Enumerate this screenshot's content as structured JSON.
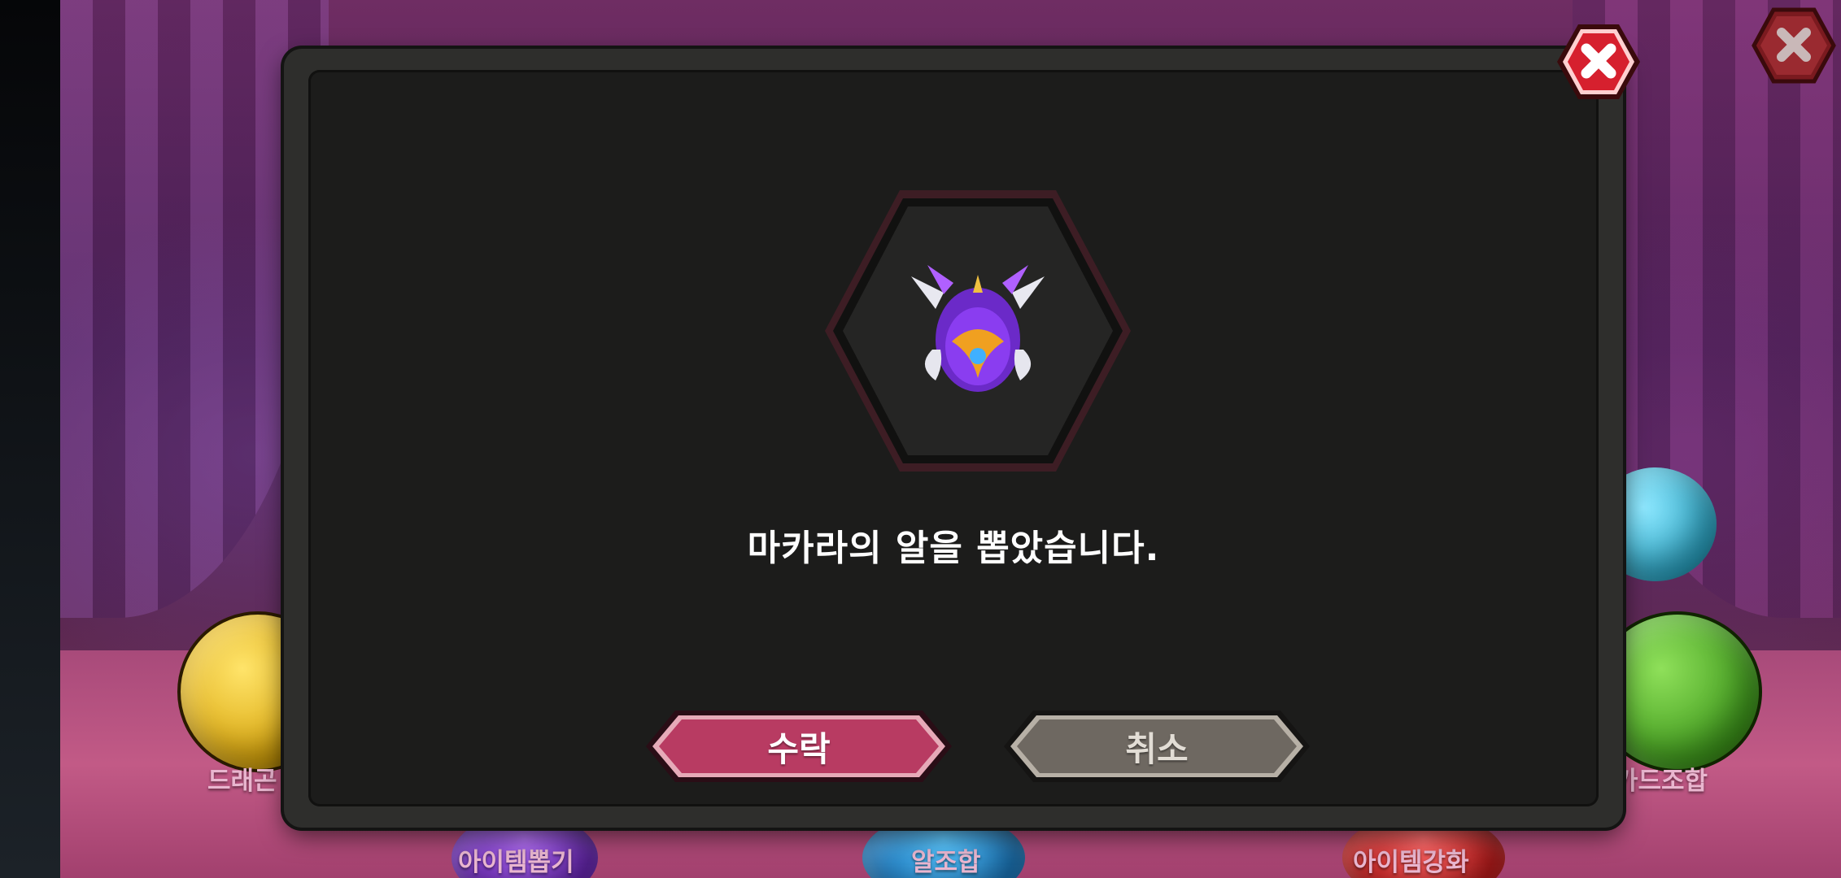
{
  "background": {
    "labels": {
      "dragon": "드래곤",
      "card_mix": "카드조합",
      "item_pick": "아이템뽑기",
      "egg_mix": "알조합",
      "item_enhance": "아이템강화"
    },
    "close_icon": "close-icon"
  },
  "dialog": {
    "message": "마카라의 알을 뽑았습니다.",
    "accept_label": "수락",
    "cancel_label": "취소",
    "item_icon": "dragon-egg-icon",
    "close_icon": "close-icon"
  },
  "colors": {
    "accept_button": "#b83b62",
    "cancel_button": "#6e6861",
    "close_button": "#d6202e",
    "panel": "#1c1c1b",
    "frame": "#2e2e2c"
  }
}
